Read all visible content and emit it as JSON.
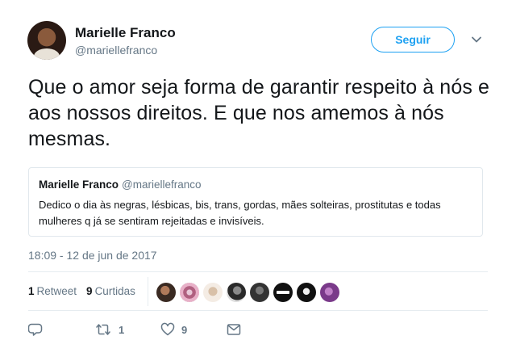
{
  "author": {
    "name": "Marielle Franco",
    "handle": "@mariellefranco"
  },
  "follow_label": "Seguir",
  "tweet_text": "Que o amor seja forma de garantir respeito à nós e aos nossos direitos. E que nos amemos à nós mesmas.",
  "quoted": {
    "name": "Marielle Franco",
    "handle": "@mariellefranco",
    "text": "Dedico o dia às negras, lésbicas, bis, trans, gordas, mães solteiras, prostitutas e todas mulheres q já se sentiram rejeitadas e invisíveis."
  },
  "timestamp": "18:09 - 12 de jun de 2017",
  "stats": {
    "retweets_count": "1",
    "retweets_label": "Retweet",
    "likes_count": "9",
    "likes_label": "Curtidas"
  },
  "actions": {
    "retweet_count": "1",
    "like_count": "9"
  },
  "colors": {
    "accent": "#1da1f2",
    "secondary_text": "#657786",
    "border": "#e1e8ed"
  },
  "icons": [
    "chevron-down-icon",
    "reply-icon",
    "retweet-icon",
    "heart-icon",
    "message-icon"
  ]
}
